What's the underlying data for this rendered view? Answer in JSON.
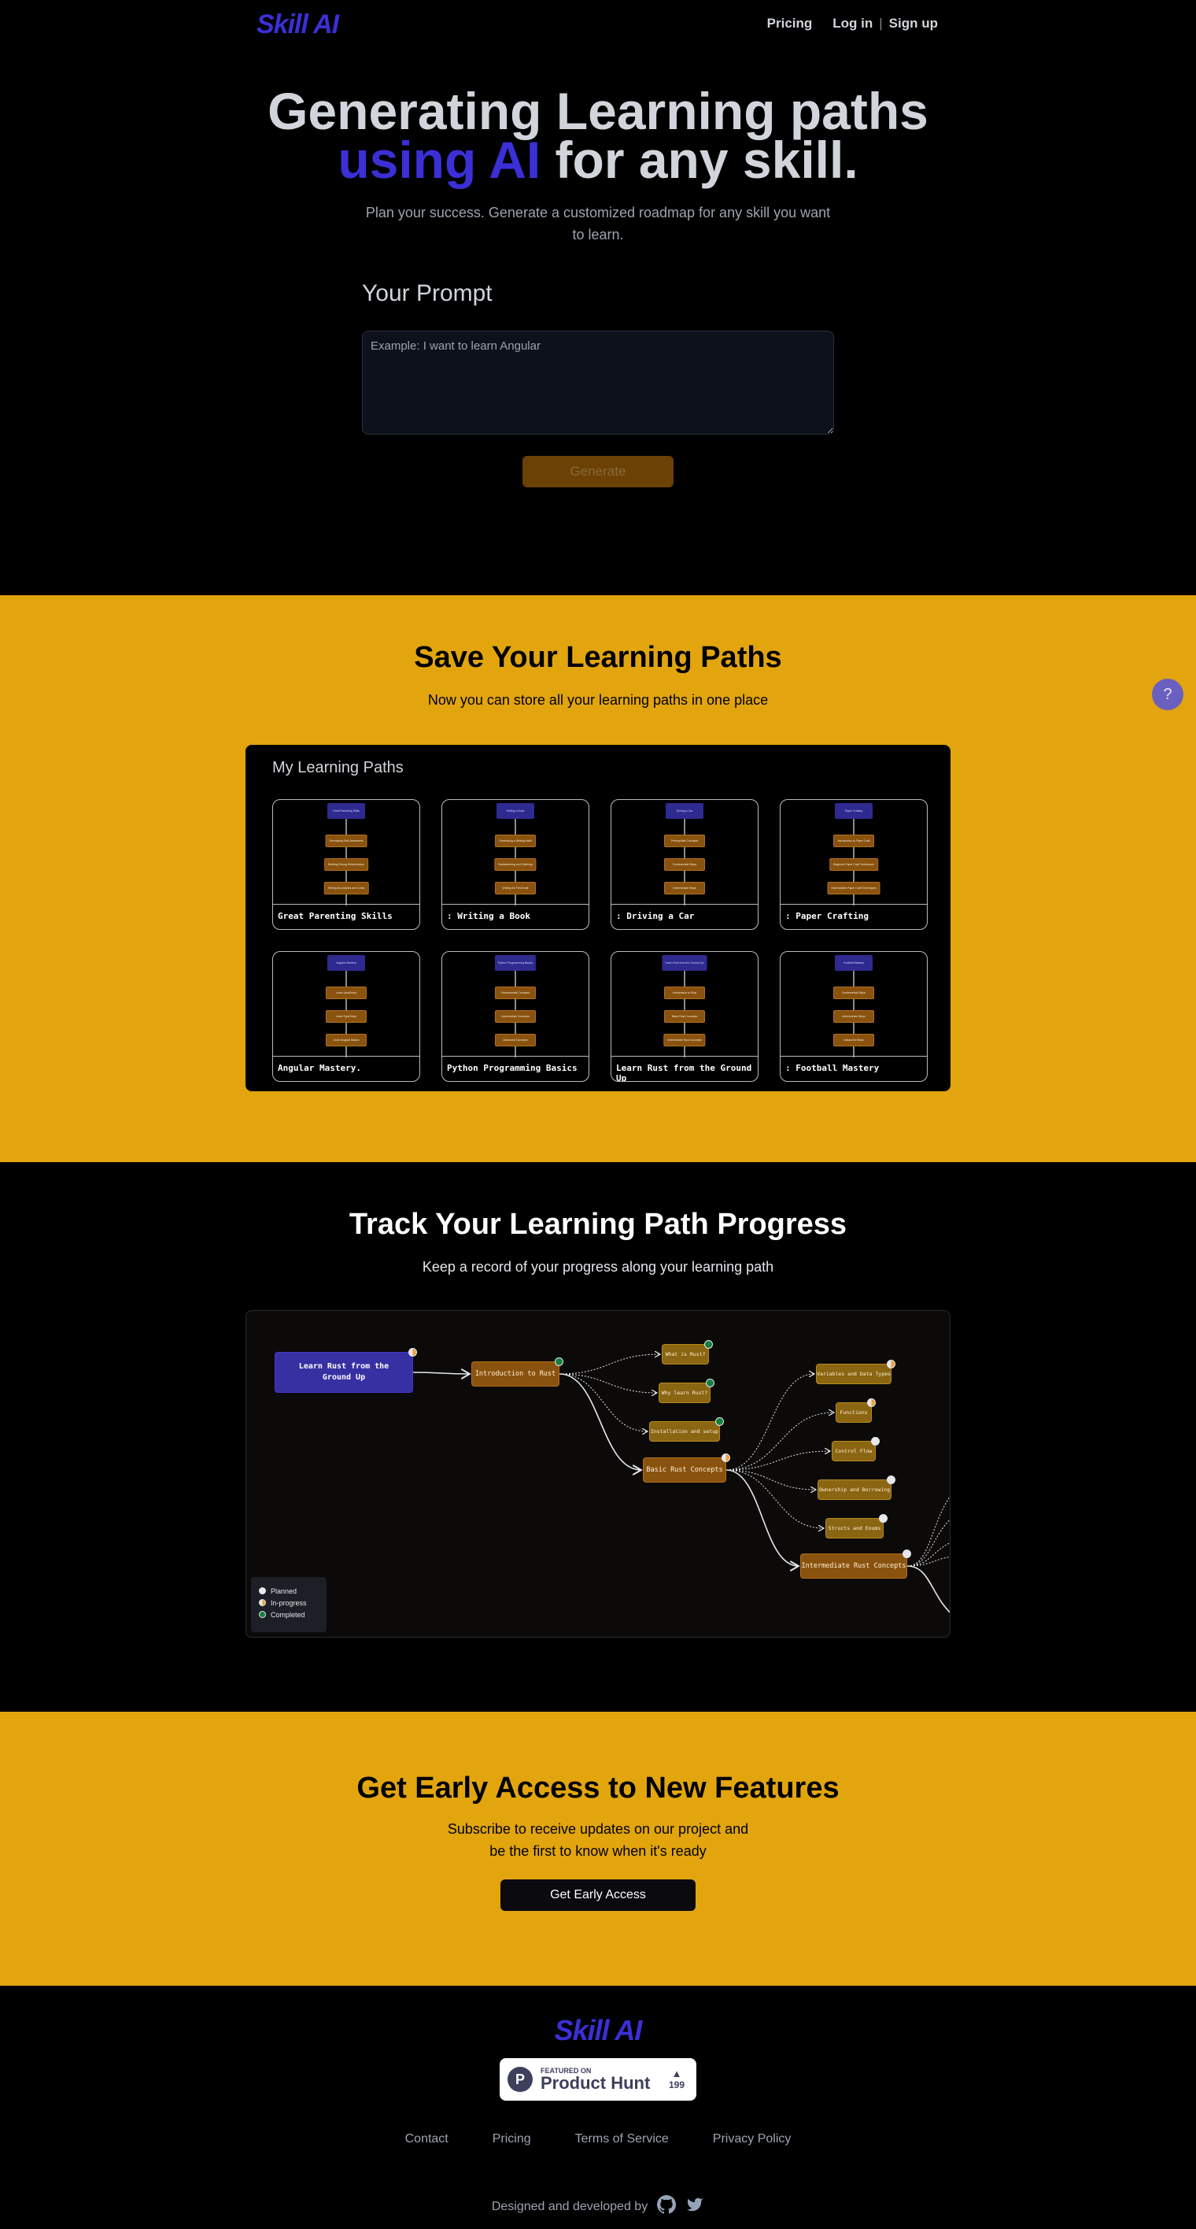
{
  "header": {
    "logo": "Skill AI",
    "nav": {
      "pricing": "Pricing",
      "login": "Log in",
      "separator": "|",
      "signup": "Sign up"
    }
  },
  "hero": {
    "title_line1": "Generating Learning paths",
    "title_accent": "using AI",
    "title_rest": " for any skill.",
    "subtitle": "Plan your success. Generate a customized roadmap for any skill you want to learn.",
    "prompt_label": "Your Prompt",
    "prompt_placeholder": "Example: I want to learn Angular",
    "prompt_value": "",
    "generate_label": "Generate"
  },
  "save_section": {
    "title": "Save Your Learning Paths",
    "subtitle": "Now you can store all your learning paths in one place",
    "help_label": "?",
    "panel_title": "My Learning Paths",
    "paths": [
      {
        "label": "Great Parenting Skills",
        "root": "Great Parenting Skills",
        "steps": [
          "Developing Self-Awareness",
          "Building Strong Relationships",
          "Setting Boundaries and Limits"
        ]
      },
      {
        "label": ": Writing a Book",
        "root": "Writing a Book",
        "steps": [
          "Developing a Writing Habit",
          "Brainstorming and Outlining",
          "Writing the First Draft"
        ]
      },
      {
        "label": ": Driving a Car",
        "root": "Driving a Car",
        "steps": [
          "Prerequisite Concepts",
          "Fundamental Steps",
          "Intermediate Steps"
        ]
      },
      {
        "label": ": Paper Crafting",
        "root": "Paper Crafting",
        "steps": [
          "Introduction to Paper Craft",
          "Beginner Paper Craft Techniques",
          "Intermediate Paper Craft Techniques"
        ]
      },
      {
        "label": "Angular Mastery.",
        "root": "Angular Mastery",
        "steps": [
          "Learn JavaScript",
          "Learn TypeScript",
          "Learn Angular Basics"
        ]
      },
      {
        "label": "Python Programming Basics",
        "root": "Python Programming Basics",
        "steps": [
          "Fundamental Concepts",
          "Intermediate Concepts",
          "Advanced Concepts"
        ]
      },
      {
        "label": "Learn Rust from the Ground Up",
        "root": "Learn Rust from the Ground Up",
        "steps": [
          "Introduction to Rust",
          "Basic Rust Concepts",
          "Intermediate Rust Concepts"
        ]
      },
      {
        "label": ": Football Mastery",
        "root": "Football Mastery",
        "steps": [
          "Fundamental Steps",
          "Intermediate Steps",
          "Advanced Steps"
        ]
      }
    ]
  },
  "track_section": {
    "title": "Track Your Learning Path Progress",
    "subtitle": "Keep a record of your progress along your learning path",
    "diagram": {
      "nodes": {
        "root": {
          "label": "Learn Rust from the Ground Up",
          "status": "in-progress"
        },
        "intro": {
          "label": "Introduction to Rust",
          "status": "completed"
        },
        "what": {
          "label": "What is Rust?",
          "status": "completed"
        },
        "why": {
          "label": "Why learn Rust?",
          "status": "completed"
        },
        "install": {
          "label": "Installation and setup",
          "status": "completed"
        },
        "basic": {
          "label": "Basic Rust Concepts",
          "status": "in-progress"
        },
        "vars": {
          "label": "Variables and Data Types",
          "status": "in-progress"
        },
        "funcs": {
          "label": "Functions",
          "status": "in-progress"
        },
        "flow": {
          "label": "Control Flow",
          "status": "planned"
        },
        "own": {
          "label": "Ownership and Borrowing",
          "status": "planned"
        },
        "structs": {
          "label": "Structs and Enums",
          "status": "planned"
        },
        "inter": {
          "label": "Intermediate Rust Concepts",
          "status": "planned"
        }
      },
      "legend": {
        "planned": "Planned",
        "in_progress": "In-progress",
        "completed": "Completed"
      }
    }
  },
  "early_access": {
    "title": "Get Early Access to New Features",
    "subtitle_line1": "Subscribe to receive updates on our project and",
    "subtitle_line2": "be the first to know when it's ready",
    "button_label": "Get Early Access"
  },
  "footer": {
    "logo": "Skill AI",
    "product_hunt": {
      "featured": "FEATURED ON",
      "name": "Product Hunt",
      "votes": "199",
      "logo_letter": "P"
    },
    "links": [
      "Contact",
      "Pricing",
      "Terms of Service",
      "Privacy Policy"
    ],
    "credit": "Designed and developed by"
  },
  "colors": {
    "brand": "#3b2fd6",
    "accent_yellow": "#e2a50e",
    "root_node": "#3730a3",
    "topic_node": "#8a520f",
    "completed": "#15803d",
    "in_progress": "#e9a23b",
    "planned": "#e5e7eb"
  }
}
